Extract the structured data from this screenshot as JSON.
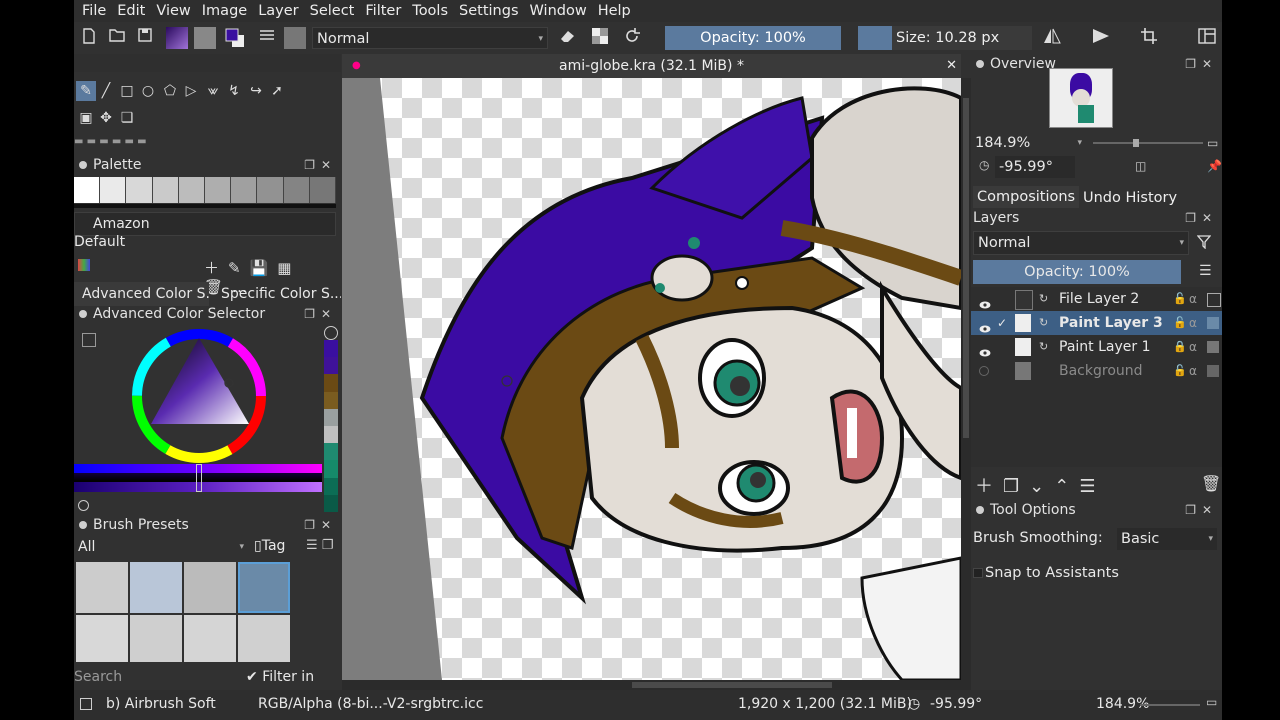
{
  "menu": [
    "File",
    "Edit",
    "View",
    "Image",
    "Layer",
    "Select",
    "Filter",
    "Tools",
    "Settings",
    "Window",
    "Help"
  ],
  "toolbar": {
    "blend_mode": "Normal",
    "opacity_label": "Opacity: 100%",
    "size_label": "Size: 10.28 px"
  },
  "document": {
    "title": "ami-globe.kra (32.1 MiB) *"
  },
  "palette": {
    "title": "Palette",
    "palette_name": "Amazon",
    "group_name": "Default",
    "swatches": [
      "#ffffff",
      "#eaeaea",
      "#d8d8d8",
      "#cacaca",
      "#bcbcbc",
      "#aeaeae",
      "#a0a0a0",
      "#929292",
      "#848484",
      "#777777"
    ]
  },
  "color_selector": {
    "tab_advanced": "Advanced Color S...",
    "tab_specific": "Specific Color S...",
    "title": "Advanced Color Selector",
    "history_colors": [
      "#3a0fa0",
      "#3f1299",
      "#6b4a14",
      "#7a5c20",
      "#9aa0a0",
      "#c0c0c0",
      "#1f8a70",
      "#168a6a",
      "#0c6d55",
      "#0a5a47"
    ]
  },
  "brush_presets": {
    "title": "Brush Presets",
    "filter_value": "All",
    "tag_label": "Tag",
    "search_placeholder": "Search",
    "filter_in_tag": "Filter in Tag"
  },
  "overview": {
    "title": "Overview",
    "zoom": "184.9%",
    "rotation": "-95.99°"
  },
  "tabs": {
    "compositions": "Compositions",
    "undo_history": "Undo History"
  },
  "layers": {
    "title": "Layers",
    "blend_mode": "Normal",
    "opacity_label": "Opacity:  100%",
    "items": [
      {
        "name": "File Layer 2",
        "active": false,
        "visible": true
      },
      {
        "name": "Paint Layer 3",
        "active": true,
        "visible": true
      },
      {
        "name": "Paint Layer 1",
        "active": false,
        "visible": true
      },
      {
        "name": "Background",
        "active": false,
        "visible": false
      }
    ]
  },
  "tool_options": {
    "title": "Tool Options",
    "brush_smoothing_label": "Brush Smoothing:",
    "brush_smoothing_value": "Basic",
    "snap_label": "Snap to Assistants"
  },
  "status": {
    "brush_name": "b) Airbrush Soft",
    "color_profile": "RGB/Alpha (8-bi...-V2-srgbtrc.icc",
    "image_size": "1,920 x 1,200 (32.1 MiB)",
    "rotation": "-95.99°",
    "zoom": "184.9%"
  },
  "colors": {
    "accent": "#5b7a9e",
    "panel_bg": "#313131",
    "selection": "#3d5f85"
  }
}
